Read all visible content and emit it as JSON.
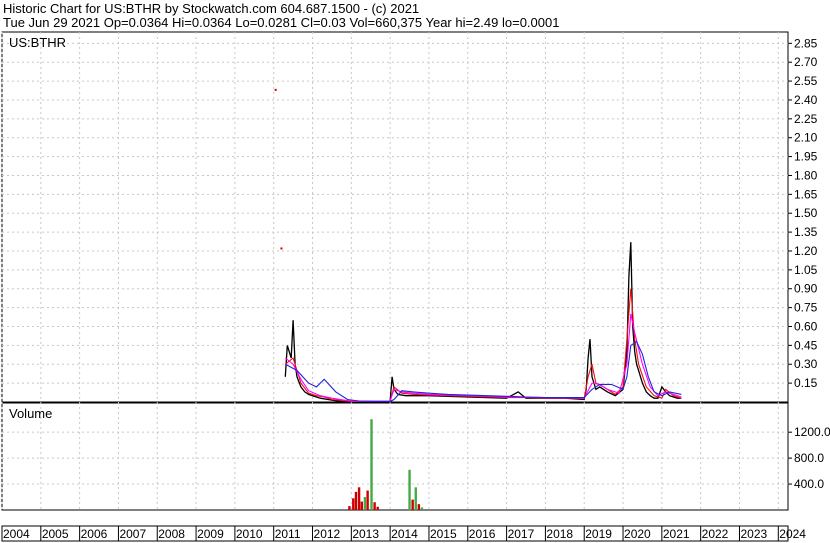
{
  "header": {
    "line1": "Historic Chart for US:BTHR by Stockwatch.com 604.687.1500 - (c) 2021",
    "line2": "Tue Jun 29 2021   Op=0.0364   Hi=0.0364   Lo=0.0281   Cl=0.03   Vol=660,375   Year hi=2.49   lo=0.0001"
  },
  "chart_data": [
    {
      "type": "line",
      "title": "US:BTHR",
      "ylim": [
        0,
        2.94
      ],
      "xlim": [
        2004,
        2024.25
      ],
      "yticks": [
        "2.85",
        "2.70",
        "2.55",
        "2.40",
        "2.25",
        "2.10",
        "1.95",
        "1.80",
        "1.65",
        "1.50",
        "1.35",
        "1.20",
        "1.05",
        "0.90",
        "0.75",
        "0.60",
        "0.45",
        "0.30",
        "0.15"
      ],
      "ytick_values": [
        2.85,
        2.7,
        2.55,
        2.4,
        2.25,
        2.1,
        1.95,
        1.8,
        1.65,
        1.5,
        1.35,
        1.2,
        1.05,
        0.9,
        0.75,
        0.6,
        0.45,
        0.3,
        0.15
      ],
      "xticks": [
        "2004",
        "2005",
        "2006",
        "2007",
        "2008",
        "2009",
        "2010",
        "2011",
        "2012",
        "2013",
        "2014",
        "2015",
        "2016",
        "2017",
        "2018",
        "2019",
        "2020",
        "2021",
        "2022",
        "2023",
        "2024"
      ],
      "grid": true,
      "series": [
        {
          "color": "#000000",
          "x": [
            2011.3,
            2011.35,
            2011.45,
            2011.5,
            2011.55,
            2011.6,
            2011.7,
            2011.8,
            2011.9,
            2012.0,
            2012.1,
            2012.2,
            2012.4,
            2012.6,
            2012.8,
            2013.0,
            2013.5,
            2014.0,
            2014.05,
            2014.1,
            2014.2,
            2014.4,
            2014.6,
            2015.0,
            2015.5,
            2016.0,
            2016.5,
            2017.0,
            2017.3,
            2017.5,
            2018.0,
            2018.5,
            2019.0,
            2019.05,
            2019.1,
            2019.15,
            2019.2,
            2019.3,
            2019.4,
            2019.6,
            2019.8,
            2020.0,
            2020.1,
            2020.15,
            2020.2,
            2020.25,
            2020.3,
            2020.35,
            2020.4,
            2020.5,
            2020.6,
            2020.7,
            2020.8,
            2020.9,
            2021.0,
            2021.1,
            2021.2,
            2021.3,
            2021.4,
            2021.5
          ],
          "y": [
            0.2,
            0.45,
            0.35,
            0.65,
            0.3,
            0.2,
            0.12,
            0.08,
            0.06,
            0.05,
            0.04,
            0.03,
            0.02,
            0.01,
            0.005,
            0.004,
            0.004,
            0.004,
            0.2,
            0.1,
            0.06,
            0.05,
            0.05,
            0.05,
            0.045,
            0.04,
            0.035,
            0.03,
            0.08,
            0.03,
            0.03,
            0.03,
            0.02,
            0.1,
            0.35,
            0.5,
            0.2,
            0.1,
            0.12,
            0.08,
            0.05,
            0.1,
            0.4,
            1.0,
            1.27,
            0.6,
            0.4,
            0.3,
            0.25,
            0.15,
            0.08,
            0.05,
            0.03,
            0.03,
            0.12,
            0.08,
            0.05,
            0.04,
            0.03,
            0.03
          ]
        },
        {
          "color": "#ee1111",
          "x": [
            2011.3,
            2011.5,
            2011.7,
            2011.9,
            2012.1,
            2012.3,
            2012.5,
            2012.8,
            2013.0,
            2013.5,
            2014.0,
            2014.1,
            2014.3,
            2014.6,
            2015.0,
            2015.5,
            2016.0,
            2016.5,
            2017.0,
            2017.5,
            2018.0,
            2018.5,
            2019.0,
            2019.1,
            2019.2,
            2019.3,
            2019.5,
            2019.8,
            2020.0,
            2020.1,
            2020.2,
            2020.3,
            2020.4,
            2020.6,
            2020.8,
            2021.0,
            2021.1,
            2021.3,
            2021.5
          ],
          "y": [
            0.3,
            0.35,
            0.15,
            0.07,
            0.05,
            0.04,
            0.02,
            0.01,
            0.005,
            0.005,
            0.005,
            0.12,
            0.07,
            0.06,
            0.055,
            0.05,
            0.045,
            0.04,
            0.035,
            0.035,
            0.03,
            0.03,
            0.03,
            0.2,
            0.3,
            0.15,
            0.12,
            0.06,
            0.12,
            0.5,
            0.9,
            0.5,
            0.3,
            0.12,
            0.05,
            0.03,
            0.1,
            0.05,
            0.03
          ]
        },
        {
          "color": "#ff00ff",
          "x": [
            2011.3,
            2011.5,
            2011.7,
            2011.9,
            2012.2,
            2012.5,
            2012.8,
            2013.0,
            2013.5,
            2014.0,
            2014.1,
            2014.3,
            2014.6,
            2015.0,
            2015.5,
            2016.0,
            2016.5,
            2017.0,
            2017.5,
            2018.0,
            2018.5,
            2019.0,
            2019.2,
            2019.4,
            2019.6,
            2019.9,
            2020.1,
            2020.2,
            2020.3,
            2020.5,
            2020.7,
            2020.9,
            2021.1,
            2021.3,
            2021.5
          ],
          "y": [
            0.35,
            0.3,
            0.18,
            0.09,
            0.05,
            0.03,
            0.015,
            0.008,
            0.006,
            0.006,
            0.1,
            0.08,
            0.07,
            0.06,
            0.055,
            0.05,
            0.045,
            0.04,
            0.038,
            0.035,
            0.033,
            0.03,
            0.15,
            0.14,
            0.1,
            0.07,
            0.3,
            0.7,
            0.55,
            0.3,
            0.12,
            0.05,
            0.08,
            0.06,
            0.04
          ]
        },
        {
          "color": "#2222dd",
          "x": [
            2011.3,
            2011.6,
            2011.9,
            2012.1,
            2012.3,
            2012.6,
            2012.9,
            2013.2,
            2013.6,
            2014.0,
            2014.1,
            2014.3,
            2014.6,
            2015.0,
            2015.5,
            2016.0,
            2016.5,
            2017.0,
            2017.5,
            2018.0,
            2018.5,
            2019.0,
            2019.2,
            2019.4,
            2019.7,
            2020.0,
            2020.1,
            2020.2,
            2020.35,
            2020.5,
            2020.65,
            2020.8,
            2021.0,
            2021.2,
            2021.5
          ],
          "y": [
            0.3,
            0.25,
            0.15,
            0.12,
            0.18,
            0.08,
            0.02,
            0.008,
            0.005,
            0.005,
            0.02,
            0.09,
            0.08,
            0.07,
            0.06,
            0.055,
            0.05,
            0.045,
            0.04,
            0.035,
            0.035,
            0.035,
            0.1,
            0.14,
            0.14,
            0.1,
            0.2,
            0.45,
            0.48,
            0.38,
            0.2,
            0.08,
            0.05,
            0.08,
            0.06
          ]
        }
      ],
      "outliers": [
        {
          "x": 2011.05,
          "y": 2.48,
          "color": "#cc0000"
        },
        {
          "x": 2011.2,
          "y": 1.22,
          "color": "#cc0000"
        }
      ]
    },
    {
      "type": "bar",
      "title": "Volume",
      "ylim": [
        0,
        1650
      ],
      "yticks": [
        "1200.0",
        "800.0",
        "400.0"
      ],
      "ytick_values": [
        1200,
        800,
        400
      ],
      "bars": [
        {
          "x": 2012.95,
          "value": 60,
          "color": "#cc0000"
        },
        {
          "x": 2013.05,
          "value": 180,
          "color": "#cc0000"
        },
        {
          "x": 2013.12,
          "value": 280,
          "color": "#cc0000"
        },
        {
          "x": 2013.2,
          "value": 350,
          "color": "#cc0000"
        },
        {
          "x": 2013.27,
          "value": 130,
          "color": "#cc0000"
        },
        {
          "x": 2013.35,
          "value": 200,
          "color": "#44aa44"
        },
        {
          "x": 2013.42,
          "value": 300,
          "color": "#cc0000"
        },
        {
          "x": 2013.52,
          "value": 1400,
          "color": "#44aa44"
        },
        {
          "x": 2013.6,
          "value": 120,
          "color": "#cc0000"
        },
        {
          "x": 2013.68,
          "value": 50,
          "color": "#cc0000"
        },
        {
          "x": 2014.5,
          "value": 620,
          "color": "#44aa44"
        },
        {
          "x": 2014.58,
          "value": 160,
          "color": "#cc0000"
        },
        {
          "x": 2014.66,
          "value": 350,
          "color": "#44aa44"
        },
        {
          "x": 2014.74,
          "value": 90,
          "color": "#cc0000"
        },
        {
          "x": 2014.82,
          "value": 40,
          "color": "#44aa44"
        }
      ]
    }
  ]
}
